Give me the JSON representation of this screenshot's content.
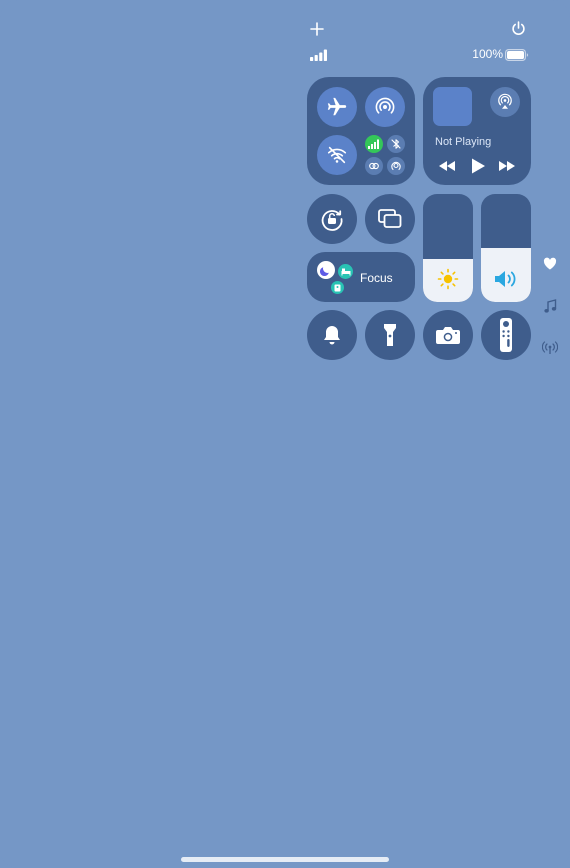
{
  "status": {
    "battery_percent_label": "100%",
    "battery_level": 1.0,
    "signal_bars": 4
  },
  "connectivity": {
    "airplane_mode": true,
    "airdrop": true,
    "wifi": false,
    "cellular": true,
    "bluetooth": false,
    "vpn": false,
    "personal_hotspot": false
  },
  "now_playing": {
    "label": "Not Playing"
  },
  "focus": {
    "label": "Focus"
  },
  "sliders": {
    "brightness_level": 0.4,
    "volume_level": 0.5
  },
  "colors": {
    "background": "#7597c6",
    "tile": "#3f5d8c",
    "accent_blue": "#5b82c9",
    "cellular_green": "#34c759",
    "moon_purple": "#5e5ce6",
    "sun_yellow": "#f7c200",
    "volume_blue": "#2aa7e0"
  },
  "icons": [
    "plus-icon",
    "power-icon",
    "signal-icon",
    "battery-icon",
    "airplane-icon",
    "airdrop-icon",
    "wifi-off-icon",
    "cellular-icon",
    "bluetooth-off-icon",
    "vpn-icon",
    "hotspot-icon",
    "airplay-icon",
    "rewind-icon",
    "play-icon",
    "fast-forward-icon",
    "rotation-lock-icon",
    "screen-mirroring-icon",
    "moon-icon",
    "bed-icon",
    "id-badge-icon",
    "sun-icon",
    "speaker-icon",
    "bell-icon",
    "flashlight-icon",
    "camera-icon",
    "remote-icon",
    "heart-icon",
    "music-note-icon",
    "antenna-icon"
  ]
}
